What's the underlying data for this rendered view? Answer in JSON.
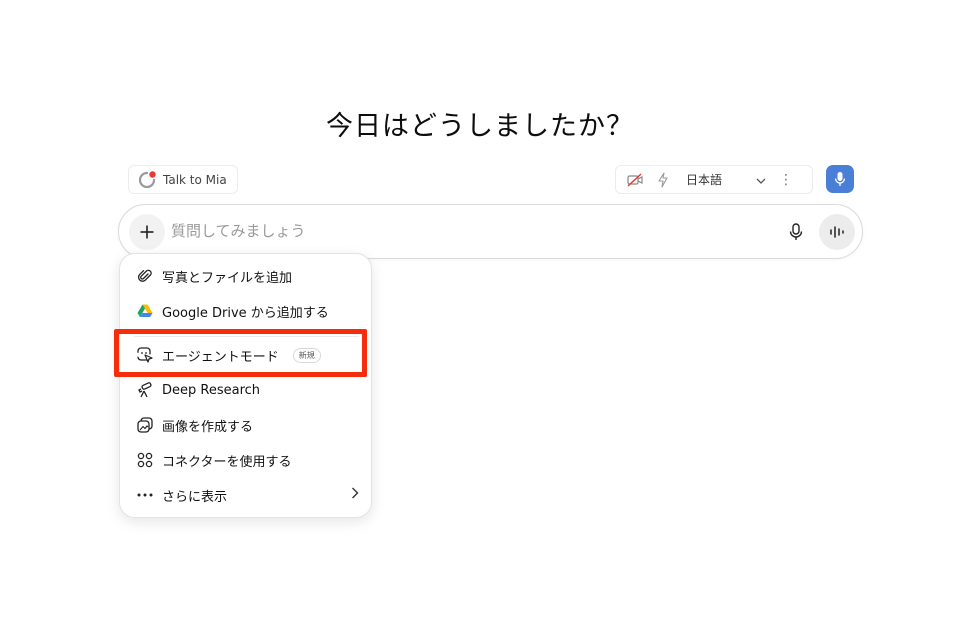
{
  "heading": "今日はどうしましたか？",
  "talk_chip": {
    "label": "Talk to Mia"
  },
  "tools_chip": {
    "language": "日本語"
  },
  "composer": {
    "placeholder": "質問してみましょう"
  },
  "menu": {
    "items": [
      {
        "label": "写真とファイルを追加",
        "icon": "paperclip-icon"
      },
      {
        "label": "Google Drive から追加する",
        "icon": "google-drive-icon"
      },
      {
        "label": "エージェントモード",
        "icon": "agent-cursor-icon",
        "badge": "新規",
        "highlighted": true
      },
      {
        "label": "Deep Research",
        "icon": "telescope-icon"
      },
      {
        "label": "画像を作成する",
        "icon": "image-create-icon"
      },
      {
        "label": "コネクターを使用する",
        "icon": "connectors-icon"
      },
      {
        "label": "さらに表示",
        "icon": "more-dots-icon",
        "has_submenu": true
      }
    ]
  },
  "colors": {
    "accent_blue": "#4a7fd8",
    "highlight_red": "#f52d0a",
    "mia_red": "#e53935"
  }
}
